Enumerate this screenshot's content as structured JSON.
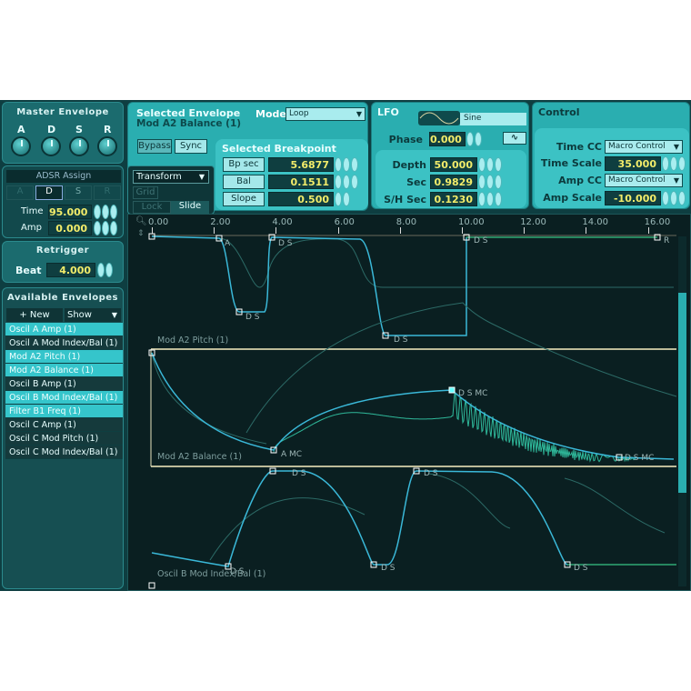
{
  "master_envelope": {
    "title": "Master Envelope",
    "knobs": [
      "A",
      "D",
      "S",
      "R"
    ]
  },
  "adsr_assign": {
    "title": "ADSR Assign",
    "tabs": [
      "A",
      "D",
      "S",
      "R"
    ],
    "active_tab": "D",
    "time_label": "Time",
    "time_value": "95.000",
    "amp_label": "Amp",
    "amp_value": "0.000"
  },
  "retrigger": {
    "title": "Retrigger",
    "beat_label": "Beat",
    "beat_value": "4.000"
  },
  "available_envelopes": {
    "title": "Available Envelopes",
    "new_label": "+ New",
    "show_label": "Show",
    "items": [
      {
        "label": "Oscil A Amp (1)",
        "selected": true
      },
      {
        "label": "Oscil A Mod Index/Bal (1)",
        "selected": false
      },
      {
        "label": "Mod A2 Pitch (1)",
        "selected": true
      },
      {
        "label": "Mod A2 Balance (1)",
        "selected": true
      },
      {
        "label": "Oscil B Amp (1)",
        "selected": false
      },
      {
        "label": "Oscil B Mod Index/Bal (1)",
        "selected": true
      },
      {
        "label": "Filter B1 Freq (1)",
        "selected": true
      },
      {
        "label": "Oscil C Amp (1)",
        "selected": false
      },
      {
        "label": "Oscil C Mod Pitch (1)",
        "selected": false
      },
      {
        "label": "Oscil C Mod Index/Bal (1)",
        "selected": false
      }
    ]
  },
  "selected_envelope": {
    "title": "Selected Envelope",
    "name": "Mod A2 Balance (1)",
    "mode_label": "Mode",
    "mode_value": "Loop",
    "bypass_label": "Bypass",
    "sync_label": "Sync"
  },
  "selected_breakpoint": {
    "title": "Selected Breakpoint",
    "rows": [
      {
        "label": "Bp sec",
        "value": "5.6877"
      },
      {
        "label": "Bal",
        "value": "0.1511"
      },
      {
        "label": "Slope",
        "value": "0.500"
      }
    ]
  },
  "transform": {
    "dropdown": "Transform",
    "grid_label": "Grid",
    "lock_label": "Lock",
    "slide_label": "Slide"
  },
  "lfo": {
    "title": "LFO",
    "wave": "Sine",
    "phase_label": "Phase",
    "phase_value": "0.000",
    "rows": [
      {
        "label": "Depth",
        "value": "50.000"
      },
      {
        "label": "Sec",
        "value": "0.9829"
      },
      {
        "label": "S/H Sec",
        "value": "0.1230"
      }
    ]
  },
  "control": {
    "title": "Control",
    "time_cc_label": "Time CC",
    "time_cc_value": "Macro Control",
    "time_scale_label": "Time Scale",
    "time_scale_value": "35.000",
    "amp_cc_label": "Amp CC",
    "amp_cc_value": "Macro Control",
    "amp_scale_label": "Amp Scale",
    "amp_scale_value": "-10.000"
  },
  "editor": {
    "ticks": [
      "0.00",
      "2.00",
      "4.00",
      "6.00",
      "8.00",
      "10.00",
      "12.00",
      "14.00",
      "16.00"
    ],
    "lanes": [
      {
        "label": "Mod A2 Pitch (1)",
        "bp_labels": [
          "A",
          "D S",
          "D S",
          "D S",
          "D S",
          "R"
        ]
      },
      {
        "label": "Mod A2 Balance (1)",
        "bp_labels": [
          "A MC",
          "D S MC",
          "D S MC"
        ]
      },
      {
        "label": "Oscil B Mod Index/Bal (1)",
        "bp_labels": [
          "D S",
          "D S",
          "D S",
          "D S",
          "D S"
        ]
      }
    ]
  },
  "colors": {
    "curve": "#3ab8d8",
    "value_text": "#f2ec6a",
    "highlight": "#35c5cb"
  }
}
